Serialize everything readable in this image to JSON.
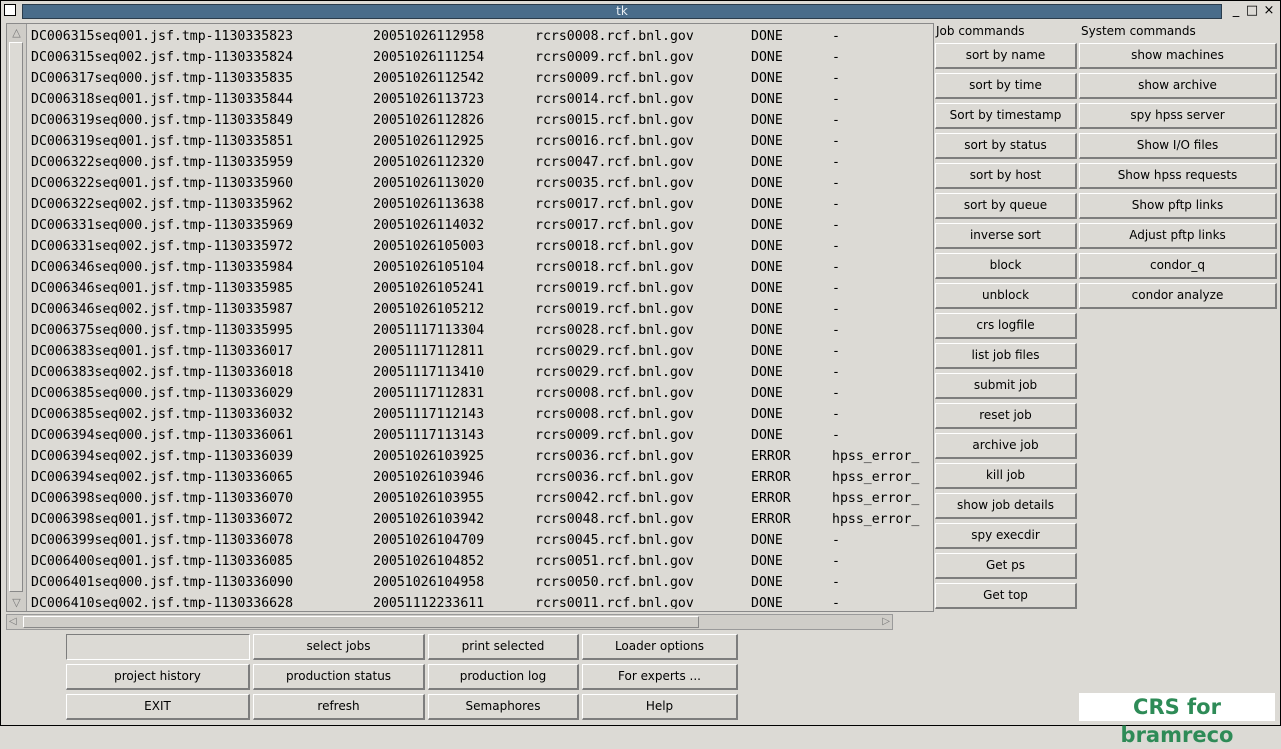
{
  "window": {
    "title": "tk",
    "controls": [
      "_",
      "□",
      "×"
    ]
  },
  "jobs": [
    {
      "name": "DC006315seq001.jsf.tmp-1130335823",
      "time": "20051026112958",
      "host": "rcrs0008.rcf.bnl.gov",
      "status": "DONE",
      "note": "-"
    },
    {
      "name": "DC006315seq002.jsf.tmp-1130335824",
      "time": "20051026111254",
      "host": "rcrs0009.rcf.bnl.gov",
      "status": "DONE",
      "note": "-"
    },
    {
      "name": "DC006317seq000.jsf.tmp-1130335835",
      "time": "20051026112542",
      "host": "rcrs0009.rcf.bnl.gov",
      "status": "DONE",
      "note": "-"
    },
    {
      "name": "DC006318seq001.jsf.tmp-1130335844",
      "time": "20051026113723",
      "host": "rcrs0014.rcf.bnl.gov",
      "status": "DONE",
      "note": "-"
    },
    {
      "name": "DC006319seq000.jsf.tmp-1130335849",
      "time": "20051026112826",
      "host": "rcrs0015.rcf.bnl.gov",
      "status": "DONE",
      "note": "-"
    },
    {
      "name": "DC006319seq001.jsf.tmp-1130335851",
      "time": "20051026112925",
      "host": "rcrs0016.rcf.bnl.gov",
      "status": "DONE",
      "note": "-"
    },
    {
      "name": "DC006322seq000.jsf.tmp-1130335959",
      "time": "20051026112320",
      "host": "rcrs0047.rcf.bnl.gov",
      "status": "DONE",
      "note": "-"
    },
    {
      "name": "DC006322seq001.jsf.tmp-1130335960",
      "time": "20051026113020",
      "host": "rcrs0035.rcf.bnl.gov",
      "status": "DONE",
      "note": "-"
    },
    {
      "name": "DC006322seq002.jsf.tmp-1130335962",
      "time": "20051026113638",
      "host": "rcrs0017.rcf.bnl.gov",
      "status": "DONE",
      "note": "-"
    },
    {
      "name": "DC006331seq000.jsf.tmp-1130335969",
      "time": "20051026114032",
      "host": "rcrs0017.rcf.bnl.gov",
      "status": "DONE",
      "note": "-"
    },
    {
      "name": "DC006331seq002.jsf.tmp-1130335972",
      "time": "20051026105003",
      "host": "rcrs0018.rcf.bnl.gov",
      "status": "DONE",
      "note": "-"
    },
    {
      "name": "DC006346seq000.jsf.tmp-1130335984",
      "time": "20051026105104",
      "host": "rcrs0018.rcf.bnl.gov",
      "status": "DONE",
      "note": "-"
    },
    {
      "name": "DC006346seq001.jsf.tmp-1130335985",
      "time": "20051026105241",
      "host": "rcrs0019.rcf.bnl.gov",
      "status": "DONE",
      "note": "-"
    },
    {
      "name": "DC006346seq002.jsf.tmp-1130335987",
      "time": "20051026105212",
      "host": "rcrs0019.rcf.bnl.gov",
      "status": "DONE",
      "note": "-"
    },
    {
      "name": "DC006375seq000.jsf.tmp-1130335995",
      "time": "20051117113304",
      "host": "rcrs0028.rcf.bnl.gov",
      "status": "DONE",
      "note": "-"
    },
    {
      "name": "DC006383seq001.jsf.tmp-1130336017",
      "time": "20051117112811",
      "host": "rcrs0029.rcf.bnl.gov",
      "status": "DONE",
      "note": "-"
    },
    {
      "name": "DC006383seq002.jsf.tmp-1130336018",
      "time": "20051117113410",
      "host": "rcrs0029.rcf.bnl.gov",
      "status": "DONE",
      "note": "-"
    },
    {
      "name": "DC006385seq000.jsf.tmp-1130336029",
      "time": "20051117112831",
      "host": "rcrs0008.rcf.bnl.gov",
      "status": "DONE",
      "note": "-"
    },
    {
      "name": "DC006385seq002.jsf.tmp-1130336032",
      "time": "20051117112143",
      "host": "rcrs0008.rcf.bnl.gov",
      "status": "DONE",
      "note": "-"
    },
    {
      "name": "DC006394seq000.jsf.tmp-1130336061",
      "time": "20051117113143",
      "host": "rcrs0009.rcf.bnl.gov",
      "status": "DONE",
      "note": "-"
    },
    {
      "name": "DC006394seq002.jsf.tmp-1130336039",
      "time": "20051026103925",
      "host": "rcrs0036.rcf.bnl.gov",
      "status": "ERROR",
      "note": "hpss_error_"
    },
    {
      "name": "DC006394seq002.jsf.tmp-1130336065",
      "time": "20051026103946",
      "host": "rcrs0036.rcf.bnl.gov",
      "status": "ERROR",
      "note": "hpss_error_"
    },
    {
      "name": "DC006398seq000.jsf.tmp-1130336070",
      "time": "20051026103955",
      "host": "rcrs0042.rcf.bnl.gov",
      "status": "ERROR",
      "note": "hpss_error_"
    },
    {
      "name": "DC006398seq001.jsf.tmp-1130336072",
      "time": "20051026103942",
      "host": "rcrs0048.rcf.bnl.gov",
      "status": "ERROR",
      "note": "hpss_error_"
    },
    {
      "name": "DC006399seq001.jsf.tmp-1130336078",
      "time": "20051026104709",
      "host": "rcrs0045.rcf.bnl.gov",
      "status": "DONE",
      "note": "-"
    },
    {
      "name": "DC006400seq001.jsf.tmp-1130336085",
      "time": "20051026104852",
      "host": "rcrs0051.rcf.bnl.gov",
      "status": "DONE",
      "note": "-"
    },
    {
      "name": "DC006401seq000.jsf.tmp-1130336090",
      "time": "20051026104958",
      "host": "rcrs0050.rcf.bnl.gov",
      "status": "DONE",
      "note": "-"
    },
    {
      "name": "DC006410seq002.jsf.tmp-1130336628",
      "time": "20051112233611",
      "host": "rcrs0011.rcf.bnl.gov",
      "status": "DONE",
      "note": "-"
    }
  ],
  "job_commands": {
    "header": "Job commands",
    "buttons": [
      "sort by name",
      "sort by time",
      "Sort by timestamp",
      "sort by status",
      "sort by host",
      "sort by queue",
      "inverse sort",
      "block",
      "unblock",
      "crs logfile",
      "list job files",
      "submit job",
      "reset job",
      "archive job",
      "kill job",
      "show job details",
      "spy execdir",
      "Get ps",
      "Get top"
    ]
  },
  "system_commands": {
    "header": "System commands",
    "buttons": [
      "show machines",
      "show archive",
      "spy hpss server",
      "Show I/O files",
      "Show hpss requests",
      "Show pftp links",
      "Adjust pftp links",
      "condor_q",
      "condor analyze"
    ]
  },
  "bottom": {
    "entry_value": "",
    "row1": [
      "select jobs",
      "print selected",
      "Loader options"
    ],
    "row2": [
      "project history",
      "production status",
      "production log",
      "For experts ..."
    ],
    "row3": [
      "EXIT",
      "refresh",
      "Semaphores",
      "Help"
    ]
  },
  "brand": {
    "text": "CRS for bramreco",
    "color": "#2e8b57"
  }
}
